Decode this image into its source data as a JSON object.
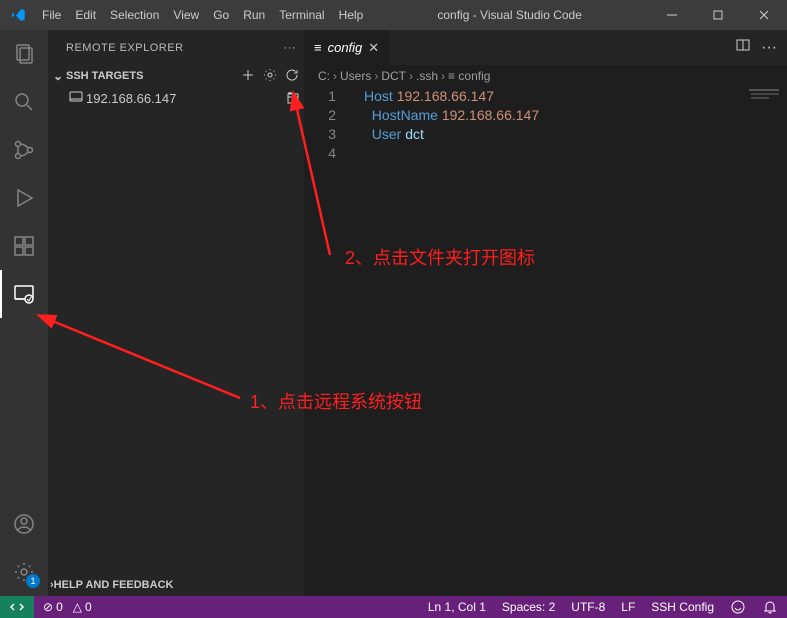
{
  "titlebar": {
    "menus": [
      "File",
      "Edit",
      "Selection",
      "View",
      "Go",
      "Run",
      "Terminal",
      "Help"
    ],
    "title": "config - Visual Studio Code"
  },
  "activitybar": {
    "top": [
      {
        "name": "explorer-icon"
      },
      {
        "name": "search-icon"
      },
      {
        "name": "scm-icon"
      },
      {
        "name": "debug-icon"
      },
      {
        "name": "extensions-icon"
      },
      {
        "name": "remote-explorer-icon",
        "active": true
      }
    ],
    "bottom": [
      {
        "name": "accounts-icon"
      },
      {
        "name": "settings-gear-icon",
        "badge": "1"
      }
    ]
  },
  "sidebar": {
    "title": "REMOTE EXPLORER",
    "more": "···",
    "section": {
      "chev": "⌄",
      "label": "SSH TARGETS",
      "icons": [
        "plus-icon",
        "gear-icon",
        "refresh-icon"
      ]
    },
    "hosts": [
      {
        "name": "192.168.66.147",
        "action_icon": "new-window-icon"
      }
    ],
    "footer": {
      "chev": "›",
      "label": "HELP AND FEEDBACK"
    }
  },
  "editor": {
    "tab": {
      "icon": "≡",
      "label": "config",
      "close": "✕"
    },
    "tab_actions": [
      "split-icon",
      "more-icon"
    ],
    "breadcrumbs": [
      "C:",
      "Users",
      "DCT",
      ".ssh",
      "config"
    ],
    "breadcrumb_last_icon": "≡",
    "code_lines": [
      {
        "n": "1",
        "tokens": [
          [
            "prop",
            "Host "
          ],
          [
            "val",
            "192.168.66.147"
          ]
        ]
      },
      {
        "n": "2",
        "tokens": [
          [
            "plain",
            "  "
          ],
          [
            "prop",
            "HostName "
          ],
          [
            "val",
            "192.168.66.147"
          ]
        ]
      },
      {
        "n": "3",
        "tokens": [
          [
            "plain",
            "  "
          ],
          [
            "prop",
            "User "
          ],
          [
            "plain",
            "dct"
          ]
        ]
      },
      {
        "n": "4",
        "tokens": []
      }
    ]
  },
  "statusbar": {
    "remote_glyph": "⇄",
    "left": [
      {
        "icon": "⊘",
        "text": "0"
      },
      {
        "icon": "△",
        "text": "0"
      }
    ],
    "right": [
      {
        "text": "Ln 1, Col 1"
      },
      {
        "text": "Spaces: 2"
      },
      {
        "text": "UTF-8"
      },
      {
        "text": "LF"
      },
      {
        "text": "SSH Config"
      },
      {
        "icon": "⊕",
        "text": ""
      },
      {
        "icon": "🔔",
        "text": ""
      }
    ]
  },
  "annotations": {
    "a1": "1、点击远程系统按钮",
    "a2": "2、点击文件夹打开图标"
  }
}
